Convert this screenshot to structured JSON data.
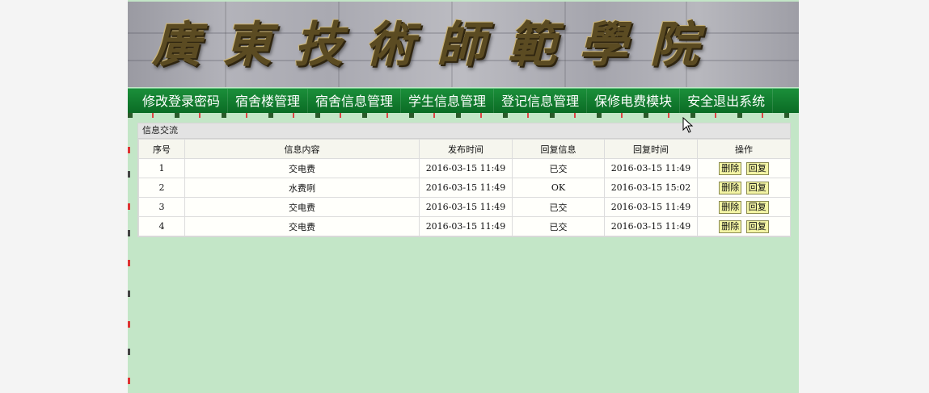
{
  "banner": {
    "title": "廣東技術師範學院"
  },
  "nav": {
    "items": [
      {
        "label": "修改登录密码"
      },
      {
        "label": "宿舍楼管理"
      },
      {
        "label": "宿舍信息管理"
      },
      {
        "label": "学生信息管理"
      },
      {
        "label": "登记信息管理"
      },
      {
        "label": "保修电费模块"
      },
      {
        "label": "安全退出系统"
      }
    ]
  },
  "panel": {
    "title": "信息交流"
  },
  "table": {
    "headers": [
      "序号",
      "信息内容",
      "发布时间",
      "回复信息",
      "回复时间",
      "操作"
    ],
    "rows": [
      {
        "no": "1",
        "content": "交电费",
        "time": "2016-03-15 11:49",
        "reply": "已交",
        "reply_time": "2016-03-15 11:49"
      },
      {
        "no": "2",
        "content": "水费咧",
        "time": "2016-03-15 11:49",
        "reply": "OK",
        "reply_time": "2016-03-15 15:02"
      },
      {
        "no": "3",
        "content": "交电费",
        "time": "2016-03-15 11:49",
        "reply": "已交",
        "reply_time": "2016-03-15 11:49"
      },
      {
        "no": "4",
        "content": "交电费",
        "time": "2016-03-15 11:49",
        "reply": "已交",
        "reply_time": "2016-03-15 11:49"
      }
    ],
    "delete_label": "删除",
    "reply_label": "回复"
  },
  "colors": {
    "nav_green": "#0a7a2c",
    "content_bg": "#c3e6c7",
    "button_bg": "#f3f4a4"
  }
}
